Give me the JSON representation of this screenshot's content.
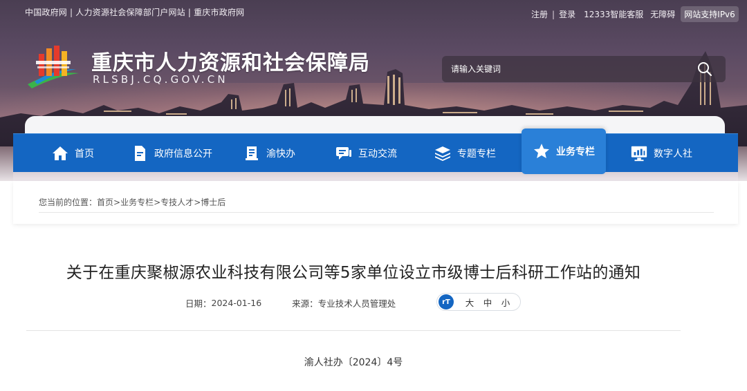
{
  "topbar": {
    "links_left": "中国政府网 | 人力资源社会保障部门户网站 | 重庆市政府网",
    "register": "注册",
    "divider": "|",
    "login": "登录",
    "service": "12333智能客服",
    "accessible": "无障碍",
    "ipv6": "网站支持IPv6"
  },
  "header": {
    "title": "重庆市人力资源和社会保障局",
    "subtitle": "RLSBJ.CQ.GOV.CN"
  },
  "search": {
    "placeholder": "请输入关键词"
  },
  "nav": {
    "items": [
      {
        "label": "首页",
        "icon": "home-icon"
      },
      {
        "label": "政府信息公开",
        "icon": "document-icon"
      },
      {
        "label": "渝快办",
        "icon": "book-icon"
      },
      {
        "label": "互动交流",
        "icon": "chat-icon"
      },
      {
        "label": "专题专栏",
        "icon": "layers-icon"
      },
      {
        "label": "业务专栏",
        "icon": "star-icon"
      },
      {
        "label": "数字人社",
        "icon": "monitor-chart-icon"
      }
    ],
    "active_index": 5
  },
  "breadcrumb": {
    "prefix": "您当前的位置：",
    "items": [
      "首页",
      "业务专栏",
      "专技人才",
      "博士后"
    ],
    "separator": ">"
  },
  "article": {
    "title": "关于在重庆聚椒源农业科技有限公司等5家单位设立市级博士后科研工作站的通知",
    "date_label": "日期：",
    "date": "2024-01-16",
    "source_label": "来源：",
    "source": "专业技术人员管理处",
    "font_icon": "rT",
    "font_large": "大",
    "font_medium": "中",
    "font_small": "小",
    "doc_number": "渝人社办〔2024〕4号"
  },
  "colors": {
    "nav_blue": "#1466c2",
    "nav_active": "#2a80d8",
    "title_text": "#222222"
  }
}
